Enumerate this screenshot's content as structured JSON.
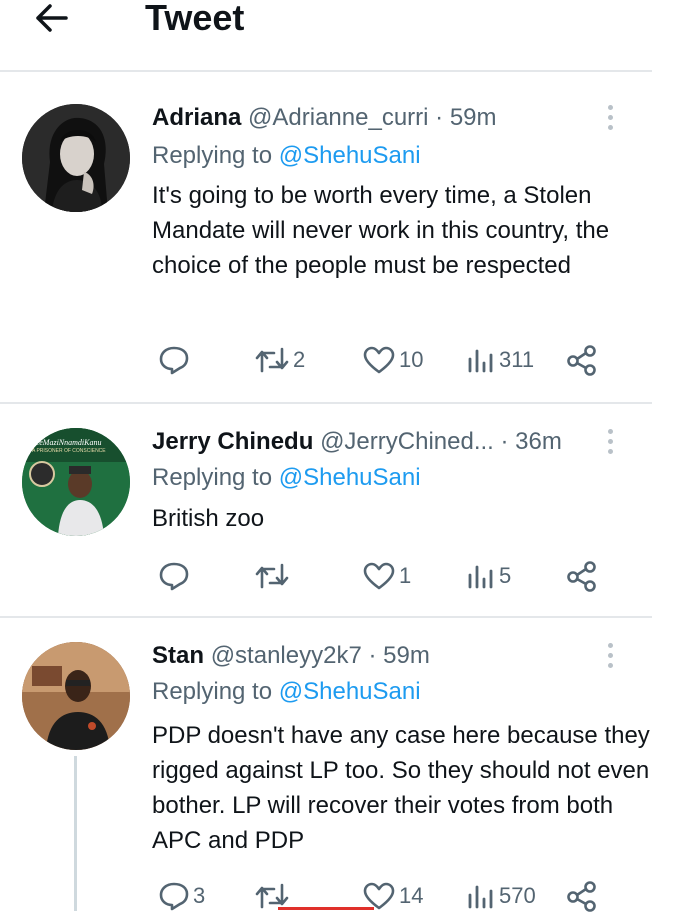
{
  "header": {
    "title": "Tweet"
  },
  "tweets": [
    {
      "name": "Adriana",
      "handle": "@Adrianne_curri",
      "time": "· 59m",
      "replying_prefix": "Replying to",
      "replying_to": "@ShehuSani",
      "text": "It's going to be worth every time, a Stolen Mandate will never work in this country, the choice of the people must be respected",
      "retweets": "2",
      "likes": "10",
      "views": "311"
    },
    {
      "name": "Jerry Chinedu",
      "handle": "@JerryChined...",
      "time": "· 36m",
      "replying_prefix": "Replying to",
      "replying_to": "@ShehuSani",
      "text": "British zoo",
      "retweets": "",
      "likes": "1",
      "views": "5",
      "avatar_caption": "FreeMaziNnamdiKanu",
      "avatar_subcaption": "A PRISONER OF CONSCIENCE"
    },
    {
      "name": "Stan",
      "handle": "@stanleyy2k7",
      "time": "· 59m",
      "replying_prefix": "Replying to",
      "replying_to": "@ShehuSani",
      "text": "PDP doesn't have any case here because they rigged against LP too. So they should not even bother. LP will recover their votes from both APC and PDP",
      "replies": "3",
      "likes": "14",
      "views": "570"
    }
  ],
  "colors": {
    "link": "#1d9bf0",
    "secondary": "#536471",
    "divider": "#e4e7ea",
    "text": "#0f1419"
  }
}
